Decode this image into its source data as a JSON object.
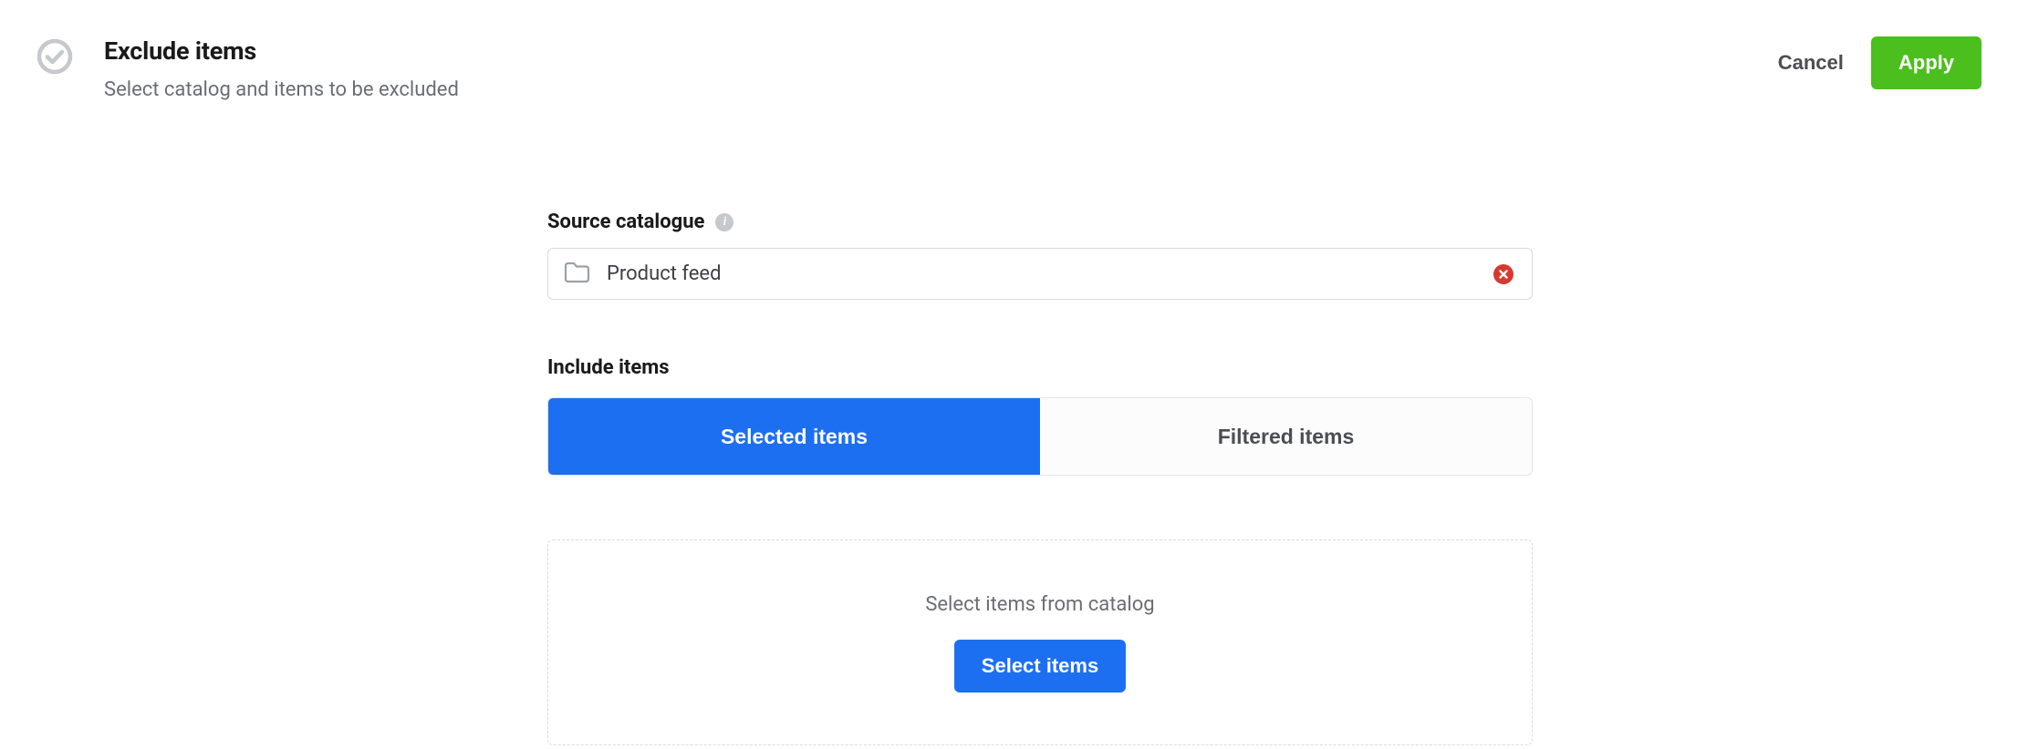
{
  "header": {
    "title": "Exclude items",
    "subtitle": "Select catalog and items to be excluded",
    "cancel_label": "Cancel",
    "apply_label": "Apply"
  },
  "form": {
    "source_label": "Source catalogue",
    "source_info_glyph": "i",
    "source_value": "Product feed",
    "include_label": "Include items",
    "tabs": {
      "selected": "Selected items",
      "filtered": "Filtered items"
    },
    "empty_hint": "Select items from catalog",
    "select_items_label": "Select items"
  }
}
